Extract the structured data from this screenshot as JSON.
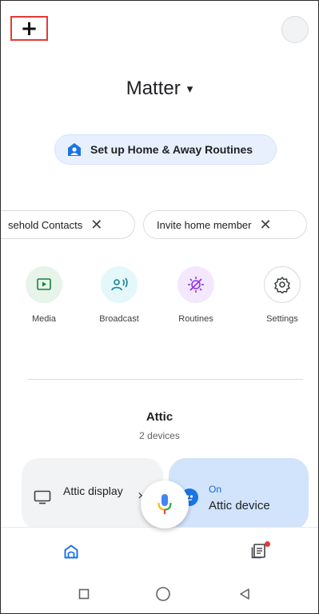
{
  "header": {
    "add_label": "+",
    "add_icon": "plus-icon",
    "avatar_icon": "account-avatar"
  },
  "home": {
    "title": "Matter",
    "caret": "▾"
  },
  "setup_chip": {
    "label": "Set up Home & Away Routines",
    "icon": "home-person-icon"
  },
  "suggestion_chips": [
    {
      "label": "sehold Contacts"
    },
    {
      "label": "Invite home member"
    }
  ],
  "chip_close": "✕",
  "favorites": [
    {
      "label": "Media",
      "icon": "media-icon",
      "color": "#e6f4ea"
    },
    {
      "label": "Broadcast",
      "icon": "broadcast-icon",
      "color": "#e4f7fb"
    },
    {
      "label": "Routines",
      "icon": "routines-icon",
      "color": "#f3e8fd"
    },
    {
      "label": "Settings",
      "icon": "gear-icon",
      "color": "#ffffff"
    }
  ],
  "room": {
    "name": "Attic",
    "count": "2 devices"
  },
  "devices": [
    {
      "name": "Attic display",
      "icon": "display-icon",
      "chevron": "›"
    },
    {
      "state": "On",
      "name": "Attic device",
      "icon": "device-icon"
    }
  ],
  "bottom_nav": {
    "home_icon": "home-icon",
    "feed_icon": "feed-icon",
    "mic_icon": "mic-icon"
  },
  "system_nav": {
    "recents_icon": "square-icon",
    "home_icon": "circle-icon",
    "back_icon": "triangle-back-icon"
  },
  "colors": {
    "accent": "#1a73e8",
    "chip_bg": "#e8f0fe",
    "active_card": "#d2e3fc",
    "notification": "#e53935"
  }
}
